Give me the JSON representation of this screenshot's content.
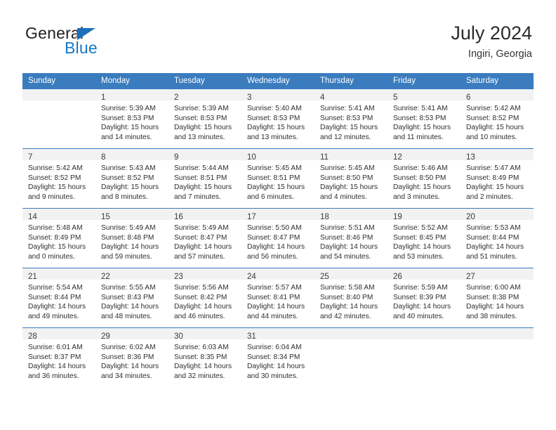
{
  "brand": {
    "name_part1": "General",
    "name_part2": "Blue",
    "accent_color": "#1878c4",
    "triangle_color": "#1c6fb8"
  },
  "header": {
    "title": "July 2024",
    "subtitle": "Ingiri, Georgia"
  },
  "theme": {
    "header_row_color": "#3a7cbe",
    "daynum_band_color": "#f2f2f2",
    "text_color": "#2e2e2e"
  },
  "weekday_headers": [
    "Sunday",
    "Monday",
    "Tuesday",
    "Wednesday",
    "Thursday",
    "Friday",
    "Saturday"
  ],
  "weeks": [
    [
      {
        "day": "",
        "lines": []
      },
      {
        "day": "1",
        "lines": [
          "Sunrise: 5:39 AM",
          "Sunset: 8:53 PM",
          "Daylight: 15 hours",
          "and 14 minutes."
        ]
      },
      {
        "day": "2",
        "lines": [
          "Sunrise: 5:39 AM",
          "Sunset: 8:53 PM",
          "Daylight: 15 hours",
          "and 13 minutes."
        ]
      },
      {
        "day": "3",
        "lines": [
          "Sunrise: 5:40 AM",
          "Sunset: 8:53 PM",
          "Daylight: 15 hours",
          "and 13 minutes."
        ]
      },
      {
        "day": "4",
        "lines": [
          "Sunrise: 5:41 AM",
          "Sunset: 8:53 PM",
          "Daylight: 15 hours",
          "and 12 minutes."
        ]
      },
      {
        "day": "5",
        "lines": [
          "Sunrise: 5:41 AM",
          "Sunset: 8:53 PM",
          "Daylight: 15 hours",
          "and 11 minutes."
        ]
      },
      {
        "day": "6",
        "lines": [
          "Sunrise: 5:42 AM",
          "Sunset: 8:52 PM",
          "Daylight: 15 hours",
          "and 10 minutes."
        ]
      }
    ],
    [
      {
        "day": "7",
        "lines": [
          "Sunrise: 5:42 AM",
          "Sunset: 8:52 PM",
          "Daylight: 15 hours",
          "and 9 minutes."
        ]
      },
      {
        "day": "8",
        "lines": [
          "Sunrise: 5:43 AM",
          "Sunset: 8:52 PM",
          "Daylight: 15 hours",
          "and 8 minutes."
        ]
      },
      {
        "day": "9",
        "lines": [
          "Sunrise: 5:44 AM",
          "Sunset: 8:51 PM",
          "Daylight: 15 hours",
          "and 7 minutes."
        ]
      },
      {
        "day": "10",
        "lines": [
          "Sunrise: 5:45 AM",
          "Sunset: 8:51 PM",
          "Daylight: 15 hours",
          "and 6 minutes."
        ]
      },
      {
        "day": "11",
        "lines": [
          "Sunrise: 5:45 AM",
          "Sunset: 8:50 PM",
          "Daylight: 15 hours",
          "and 4 minutes."
        ]
      },
      {
        "day": "12",
        "lines": [
          "Sunrise: 5:46 AM",
          "Sunset: 8:50 PM",
          "Daylight: 15 hours",
          "and 3 minutes."
        ]
      },
      {
        "day": "13",
        "lines": [
          "Sunrise: 5:47 AM",
          "Sunset: 8:49 PM",
          "Daylight: 15 hours",
          "and 2 minutes."
        ]
      }
    ],
    [
      {
        "day": "14",
        "lines": [
          "Sunrise: 5:48 AM",
          "Sunset: 8:49 PM",
          "Daylight: 15 hours",
          "and 0 minutes."
        ]
      },
      {
        "day": "15",
        "lines": [
          "Sunrise: 5:49 AM",
          "Sunset: 8:48 PM",
          "Daylight: 14 hours",
          "and 59 minutes."
        ]
      },
      {
        "day": "16",
        "lines": [
          "Sunrise: 5:49 AM",
          "Sunset: 8:47 PM",
          "Daylight: 14 hours",
          "and 57 minutes."
        ]
      },
      {
        "day": "17",
        "lines": [
          "Sunrise: 5:50 AM",
          "Sunset: 8:47 PM",
          "Daylight: 14 hours",
          "and 56 minutes."
        ]
      },
      {
        "day": "18",
        "lines": [
          "Sunrise: 5:51 AM",
          "Sunset: 8:46 PM",
          "Daylight: 14 hours",
          "and 54 minutes."
        ]
      },
      {
        "day": "19",
        "lines": [
          "Sunrise: 5:52 AM",
          "Sunset: 8:45 PM",
          "Daylight: 14 hours",
          "and 53 minutes."
        ]
      },
      {
        "day": "20",
        "lines": [
          "Sunrise: 5:53 AM",
          "Sunset: 8:44 PM",
          "Daylight: 14 hours",
          "and 51 minutes."
        ]
      }
    ],
    [
      {
        "day": "21",
        "lines": [
          "Sunrise: 5:54 AM",
          "Sunset: 8:44 PM",
          "Daylight: 14 hours",
          "and 49 minutes."
        ]
      },
      {
        "day": "22",
        "lines": [
          "Sunrise: 5:55 AM",
          "Sunset: 8:43 PM",
          "Daylight: 14 hours",
          "and 48 minutes."
        ]
      },
      {
        "day": "23",
        "lines": [
          "Sunrise: 5:56 AM",
          "Sunset: 8:42 PM",
          "Daylight: 14 hours",
          "and 46 minutes."
        ]
      },
      {
        "day": "24",
        "lines": [
          "Sunrise: 5:57 AM",
          "Sunset: 8:41 PM",
          "Daylight: 14 hours",
          "and 44 minutes."
        ]
      },
      {
        "day": "25",
        "lines": [
          "Sunrise: 5:58 AM",
          "Sunset: 8:40 PM",
          "Daylight: 14 hours",
          "and 42 minutes."
        ]
      },
      {
        "day": "26",
        "lines": [
          "Sunrise: 5:59 AM",
          "Sunset: 8:39 PM",
          "Daylight: 14 hours",
          "and 40 minutes."
        ]
      },
      {
        "day": "27",
        "lines": [
          "Sunrise: 6:00 AM",
          "Sunset: 8:38 PM",
          "Daylight: 14 hours",
          "and 38 minutes."
        ]
      }
    ],
    [
      {
        "day": "28",
        "lines": [
          "Sunrise: 6:01 AM",
          "Sunset: 8:37 PM",
          "Daylight: 14 hours",
          "and 36 minutes."
        ]
      },
      {
        "day": "29",
        "lines": [
          "Sunrise: 6:02 AM",
          "Sunset: 8:36 PM",
          "Daylight: 14 hours",
          "and 34 minutes."
        ]
      },
      {
        "day": "30",
        "lines": [
          "Sunrise: 6:03 AM",
          "Sunset: 8:35 PM",
          "Daylight: 14 hours",
          "and 32 minutes."
        ]
      },
      {
        "day": "31",
        "lines": [
          "Sunrise: 6:04 AM",
          "Sunset: 8:34 PM",
          "Daylight: 14 hours",
          "and 30 minutes."
        ]
      },
      {
        "day": "",
        "lines": []
      },
      {
        "day": "",
        "lines": []
      },
      {
        "day": "",
        "lines": []
      }
    ]
  ]
}
